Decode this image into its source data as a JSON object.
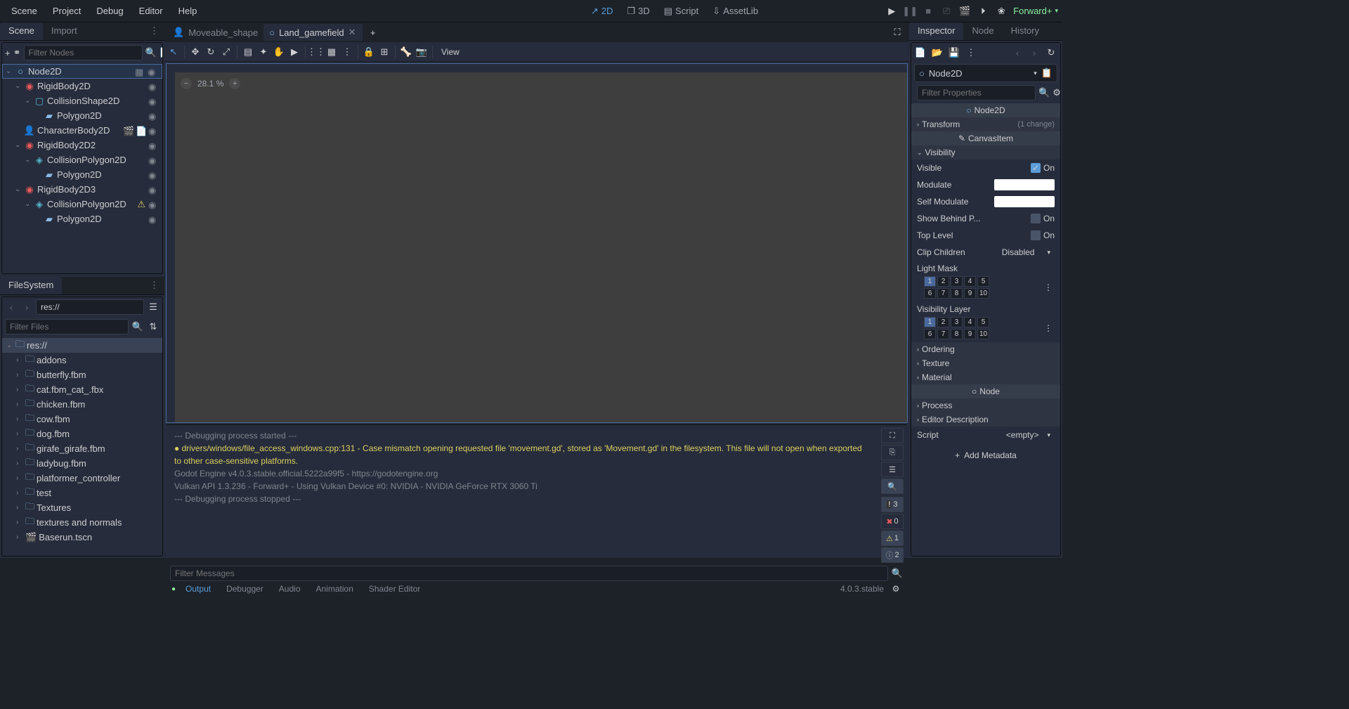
{
  "menubar": {
    "items": [
      "Scene",
      "Project",
      "Debug",
      "Editor",
      "Help"
    ]
  },
  "workspace": {
    "items": [
      "2D",
      "3D",
      "Script",
      "AssetLib"
    ],
    "active": 0
  },
  "renderer": "Forward+",
  "left_dock": {
    "tabs": [
      "Scene",
      "Import"
    ],
    "active": 0
  },
  "scene_tree": {
    "filter_placeholder": "Filter Nodes",
    "nodes": [
      {
        "name": "Node2D",
        "type": "node2d",
        "depth": 0,
        "selected": true,
        "expanded": true,
        "right": [
          "link",
          "eye"
        ]
      },
      {
        "name": "RigidBody2D",
        "type": "rigid",
        "depth": 1,
        "expanded": true,
        "right": [
          "eye"
        ]
      },
      {
        "name": "CollisionShape2D",
        "type": "collshape",
        "depth": 2,
        "expanded": true,
        "right": [
          "eye"
        ]
      },
      {
        "name": "Polygon2D",
        "type": "poly",
        "depth": 3,
        "right": [
          "eye"
        ]
      },
      {
        "name": "CharacterBody2D",
        "type": "char",
        "depth": 1,
        "right": [
          "clapper",
          "script",
          "eye"
        ]
      },
      {
        "name": "RigidBody2D2",
        "type": "rigid",
        "depth": 1,
        "expanded": true,
        "right": [
          "eye"
        ]
      },
      {
        "name": "CollisionPolygon2D",
        "type": "collpoly",
        "depth": 2,
        "expanded": true,
        "right": [
          "eye"
        ]
      },
      {
        "name": "Polygon2D",
        "type": "poly",
        "depth": 3,
        "right": [
          "eye"
        ]
      },
      {
        "name": "RigidBody2D3",
        "type": "rigid",
        "depth": 1,
        "expanded": true,
        "right": [
          "eye"
        ]
      },
      {
        "name": "CollisionPolygon2D",
        "type": "collpoly",
        "depth": 2,
        "expanded": true,
        "right": [
          "warn",
          "eye"
        ]
      },
      {
        "name": "Polygon2D",
        "type": "poly",
        "depth": 3,
        "right": [
          "eye"
        ]
      }
    ]
  },
  "filesystem": {
    "tab": "FileSystem",
    "path": "res://",
    "filter_placeholder": "Filter Files",
    "items": [
      {
        "name": "res://",
        "icon": "folder",
        "depth": 0,
        "selected": true,
        "expanded": true
      },
      {
        "name": "addons",
        "icon": "folder",
        "depth": 1
      },
      {
        "name": "butterfly.fbm",
        "icon": "folder",
        "depth": 1
      },
      {
        "name": "cat.fbm_cat_.fbx",
        "icon": "folder",
        "depth": 1
      },
      {
        "name": "chicken.fbm",
        "icon": "folder",
        "depth": 1
      },
      {
        "name": "cow.fbm",
        "icon": "folder",
        "depth": 1
      },
      {
        "name": "dog.fbm",
        "icon": "folder",
        "depth": 1
      },
      {
        "name": "girafe_girafe.fbm",
        "icon": "folder",
        "depth": 1
      },
      {
        "name": "ladybug.fbm",
        "icon": "folder",
        "depth": 1
      },
      {
        "name": "platformer_controller",
        "icon": "folder",
        "depth": 1
      },
      {
        "name": "test",
        "icon": "folder",
        "depth": 1
      },
      {
        "name": "Textures",
        "icon": "folder",
        "depth": 1
      },
      {
        "name": "textures and normals",
        "icon": "folder",
        "depth": 1
      },
      {
        "name": "Baserun.tscn",
        "icon": "scene",
        "depth": 1
      }
    ]
  },
  "scene_tabs": {
    "tabs": [
      {
        "name": "Moveable_shape",
        "icon": "char",
        "active": false
      },
      {
        "name": "Land_gamefield",
        "icon": "node2d",
        "active": true
      }
    ]
  },
  "viewport": {
    "zoom": "28.1 %",
    "view_menu": "View"
  },
  "output": {
    "lines": [
      {
        "text": "--- Debugging process started ---",
        "cls": ""
      },
      {
        "text": "  drivers/windows/file_access_windows.cpp:131 - Case mismatch opening requested file 'movement.gd', stored as 'Movement.gd' in the filesystem. This file will not open when exported to other case-sensitive platforms.",
        "cls": "output-warn",
        "dot": true
      },
      {
        "text": "Godot Engine v4.0.3.stable.official.5222a99f5 - https://godotengine.org",
        "cls": ""
      },
      {
        "text": "Vulkan API 1.3.236 - Forward+ - Using Vulkan Device #0: NVIDIA - NVIDIA GeForce RTX 3060 Ti",
        "cls": ""
      },
      {
        "text": " ",
        "cls": ""
      },
      {
        "text": "--- Debugging process stopped ---",
        "cls": ""
      }
    ],
    "filter_placeholder": "Filter Messages",
    "counts": {
      "critical": "3",
      "error": "0",
      "warning": "1",
      "info": "2"
    }
  },
  "bottom_tabs": {
    "items": [
      "Output",
      "Debugger",
      "Audio",
      "Animation",
      "Shader Editor"
    ],
    "active": 0,
    "version": "4.0.3.stable"
  },
  "right_dock": {
    "tabs": [
      "Inspector",
      "Node",
      "History"
    ],
    "active": 0
  },
  "inspector": {
    "node_name": "Node2D",
    "filter_placeholder": "Filter Properties",
    "class_headers": {
      "node2d": "Node2D",
      "canvasitem": "CanvasItem",
      "node": "Node"
    },
    "groups": {
      "transform": {
        "label": "Transform",
        "changes": "(1 change)"
      },
      "visibility": {
        "label": "Visibility"
      },
      "ordering": "Ordering",
      "texture": "Texture",
      "material": "Material",
      "process": "Process",
      "editor_desc": "Editor Description"
    },
    "props": {
      "visible": {
        "label": "Visible",
        "value": "On",
        "checked": true
      },
      "modulate": {
        "label": "Modulate"
      },
      "self_modulate": {
        "label": "Self Modulate"
      },
      "show_behind": {
        "label": "Show Behind P...",
        "value": "On",
        "checked": false
      },
      "top_level": {
        "label": "Top Level",
        "value": "On",
        "checked": false
      },
      "clip_children": {
        "label": "Clip Children",
        "value": "Disabled"
      },
      "light_mask": {
        "label": "Light Mask",
        "row1": [
          "1",
          "2",
          "3",
          "4",
          "5"
        ],
        "row2": [
          "6",
          "7",
          "8",
          "9",
          "10"
        ]
      },
      "vis_layer": {
        "label": "Visibility Layer",
        "row1": [
          "1",
          "2",
          "3",
          "4",
          "5"
        ],
        "row2": [
          "6",
          "7",
          "8",
          "9",
          "10"
        ]
      },
      "script": {
        "label": "Script",
        "value": "<empty>"
      }
    },
    "add_metadata": "Add Metadata"
  }
}
